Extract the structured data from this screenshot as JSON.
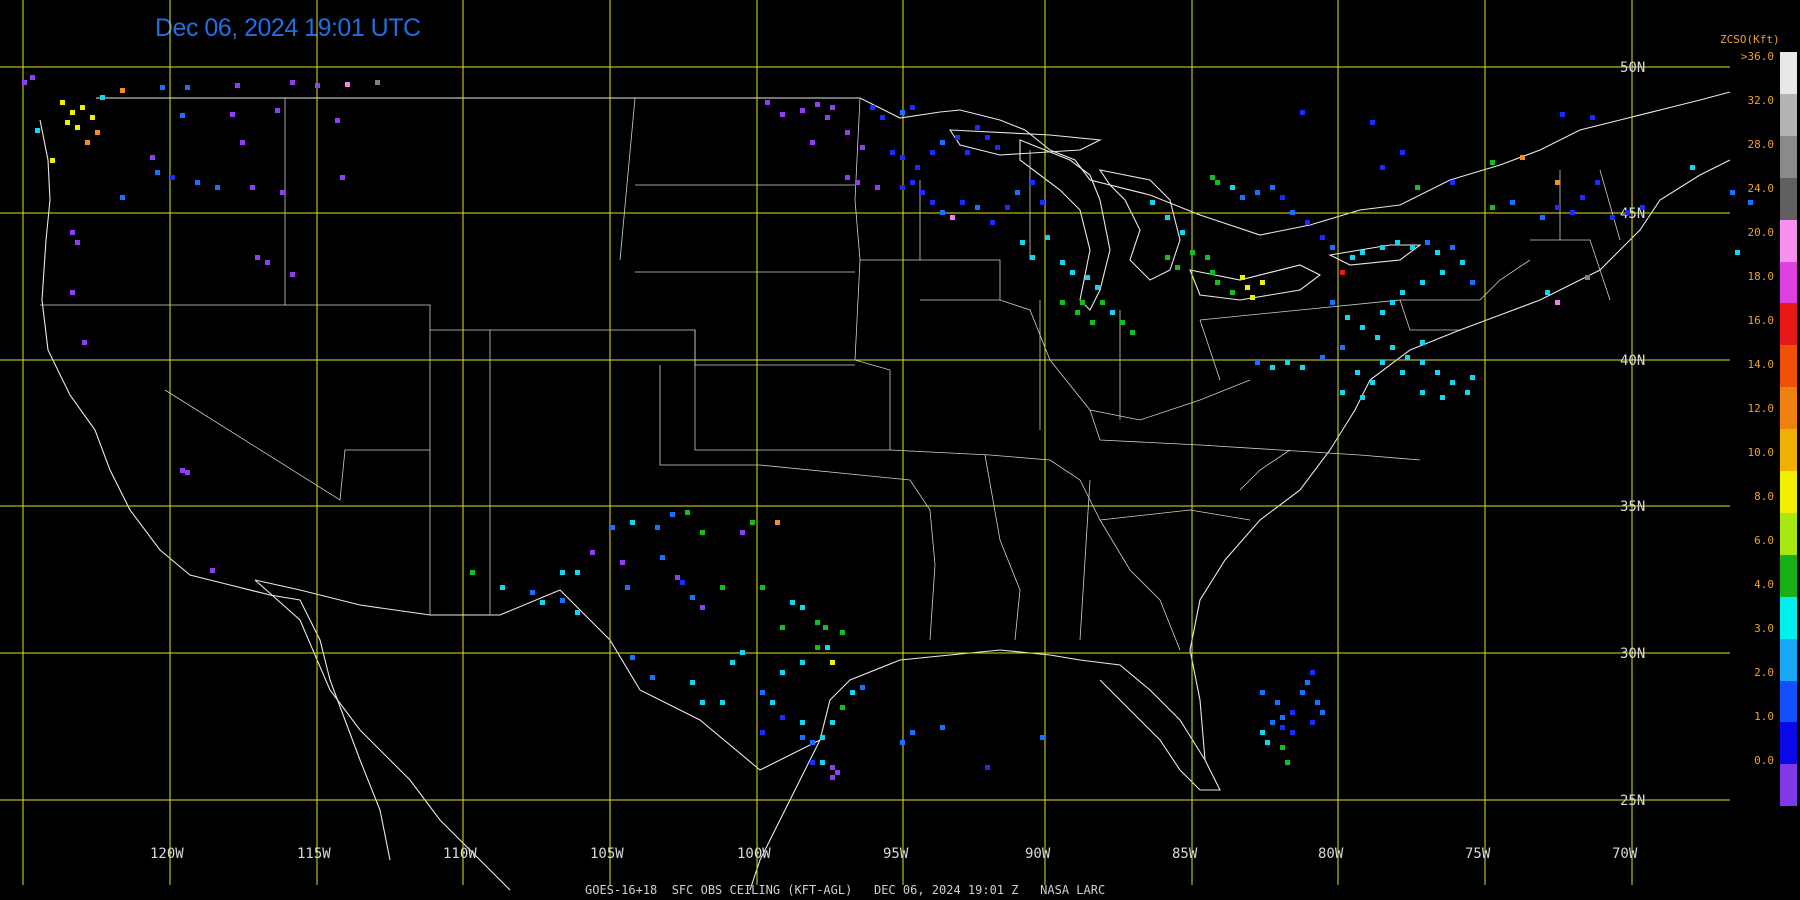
{
  "header": {
    "timestamp": "Dec 06, 2024 19:01 UTC"
  },
  "footer": {
    "caption": "GOES-16+18  SFC OBS CEILING (KFT-AGL)   DEC 06, 2024 19:01 Z   NASA LARC"
  },
  "grid": {
    "lat_labels": [
      "50N",
      "45N",
      "40N",
      "35N",
      "30N",
      "25N"
    ],
    "lon_labels": [
      "120W",
      "115W",
      "110W",
      "105W",
      "100W",
      "95W",
      "90W",
      "85W",
      "80W",
      "75W",
      "70W"
    ]
  },
  "legend": {
    "title": "ZCSO(Kft)",
    "top_label": ">36.0",
    "labels": [
      "32.0",
      "28.0",
      "24.0",
      "20.0",
      "18.0",
      "16.0",
      "14.0",
      "12.0",
      "10.0",
      "8.0",
      "6.0",
      "4.0",
      "3.0",
      "2.0",
      "1.0",
      "0.0"
    ],
    "colors": [
      "#e8e8e8",
      "#b4b4b4",
      "#8a8a8a",
      "#606060",
      "#f890f0",
      "#e040e0",
      "#e81818",
      "#f05008",
      "#f08010",
      "#f0b000",
      "#f0f000",
      "#a8e810",
      "#18b018",
      "#00f0f0",
      "#18a8f8",
      "#1050ff",
      "#0808e8",
      "#8038e8"
    ]
  },
  "stations": {
    "purple": "#8f3ff0",
    "blue": "#1a2cff",
    "mblue": "#1870ff",
    "cyan": "#10d8f0",
    "green": "#10c020",
    "yellow": "#f0f000",
    "orange": "#f09020",
    "red": "#e02020",
    "pink": "#f080f0",
    "gray": "#808080"
  }
}
